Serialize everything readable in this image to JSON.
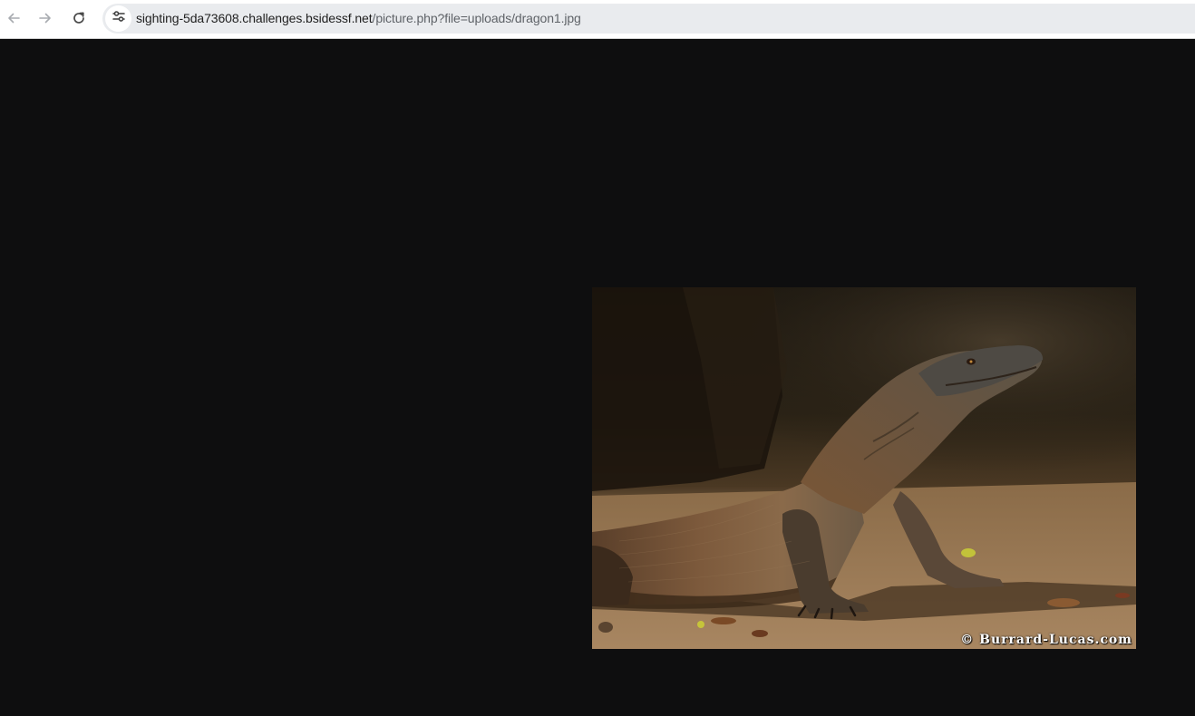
{
  "browser": {
    "back_icon": "arrow-left-icon",
    "forward_icon": "arrow-right-icon",
    "reload_icon": "reload-icon",
    "site_info_icon": "tune-icon",
    "url_host": "sighting-5da73608.challenges.bsidessf.net",
    "url_path": "/picture.php?file=uploads/dragon1.jpg"
  },
  "page": {
    "background": "#0e0e0f",
    "image": {
      "subject": "Komodo dragon",
      "watermark": "© Burrard-Lucas.com"
    }
  }
}
